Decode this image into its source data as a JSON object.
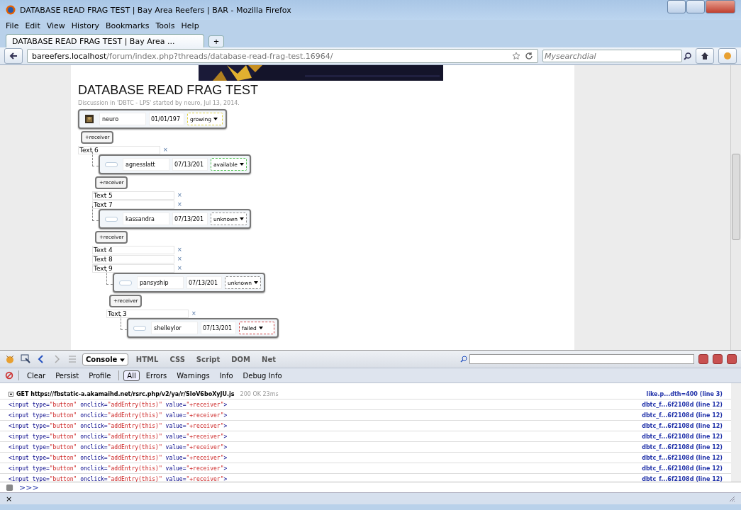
{
  "window": {
    "title": "DATABASE READ FRAG TEST | Bay Area Reefers | BAR - Mozilla Firefox"
  },
  "menu": [
    "File",
    "Edit",
    "View",
    "History",
    "Bookmarks",
    "Tools",
    "Help"
  ],
  "tabs": [
    {
      "label": "DATABASE READ FRAG TEST | Bay Area ...",
      "selected": true
    }
  ],
  "new_tab": "+",
  "address": {
    "host": "bareefers.localhost",
    "path": "/forum/index.php?threads/database-read-frag-test.16964/"
  },
  "search": {
    "placeholder": "Mysearchdial"
  },
  "page": {
    "title": "DATABASE READ FRAG TEST",
    "meta": "Discussion in 'DBTC - LPS' started by neuro, Jul 13, 2014.",
    "tree": {
      "card": {
        "name": "neuro",
        "date": "01/01/197",
        "status": {
          "label": "growing",
          "color": "#e0d040"
        }
      },
      "button": "+receiver",
      "texts": [
        {
          "value": "Text 6",
          "remove": "×"
        }
      ],
      "children": [
        {
          "card": {
            "kind": "blank",
            "name": "agnesslatt",
            "date": "07/13/201",
            "status": {
              "label": "available",
              "color": "#50c050"
            }
          },
          "button": "+receiver",
          "texts": [
            {
              "value": "Text 5",
              "remove": "×"
            },
            {
              "value": "Text 7",
              "remove": "×"
            }
          ]
        },
        {
          "card": {
            "kind": "blank",
            "name": "kassandra",
            "date": "07/13/201",
            "status": {
              "label": "unknown",
              "color": "#909090"
            }
          },
          "button": "+receiver",
          "texts": [
            {
              "value": "Text 4",
              "remove": "×"
            },
            {
              "value": "Text 8",
              "remove": "×"
            },
            {
              "value": "Text 9",
              "remove": "×"
            }
          ],
          "children": [
            {
              "card": {
                "kind": "blank",
                "name": "pansyship",
                "date": "07/13/201",
                "status": {
                  "label": "unknown",
                  "color": "#909090"
                }
              },
              "button": "+receiver",
              "texts": [
                {
                  "value": "Text 3",
                  "remove": "×"
                }
              ],
              "children": [
                {
                  "card": {
                    "kind": "blank",
                    "name": "shelleylor",
                    "date": "07/13/201",
                    "status": {
                      "label": "failed",
                      "color": "#d04040"
                    }
                  }
                }
              ]
            }
          ]
        }
      ]
    }
  },
  "firebug": {
    "panel_menu": "Console",
    "panels": [
      {
        "label": "HTML",
        "selected": false
      },
      {
        "label": "CSS",
        "selected": false
      },
      {
        "label": "Script",
        "selected": false
      },
      {
        "label": "DOM",
        "selected": false
      },
      {
        "label": "Net",
        "selected": false
      }
    ],
    "actions": [
      "Clear",
      "Persist",
      "Profile"
    ],
    "filters": [
      {
        "label": "All",
        "selected": true
      },
      {
        "label": "Errors",
        "selected": false
      },
      {
        "label": "Warnings",
        "selected": false
      },
      {
        "label": "Info",
        "selected": false
      },
      {
        "label": "Debug Info",
        "selected": false
      }
    ],
    "log": [
      {
        "kind": "request",
        "text": "GET https://fbstatic-a.akamaihd.net/rsrc.php/v2/ya/r/SIoV6boXyJU.js",
        "status": "200 OK 23ms",
        "source": "like.p...dth=400 (line 3)"
      },
      {
        "kind": "markup",
        "parts": [
          {
            "kind": "tag",
            "text": "<input type="
          },
          {
            "kind": "value",
            "text": "\"button\""
          },
          {
            "kind": "tag",
            "text": " onclick="
          },
          {
            "kind": "value",
            "text": "\"addEntry(this)\""
          },
          {
            "kind": "tag",
            "text": " value="
          },
          {
            "kind": "value",
            "text": "\"+receiver\""
          },
          {
            "kind": "tag",
            "text": ">"
          }
        ],
        "source": "dbtc_f...6f2108d (line 12)"
      },
      {
        "kind": "markup",
        "parts": [
          {
            "kind": "tag",
            "text": "<input type="
          },
          {
            "kind": "value",
            "text": "\"button\""
          },
          {
            "kind": "tag",
            "text": " onclick="
          },
          {
            "kind": "value",
            "text": "\"addEntry(this)\""
          },
          {
            "kind": "tag",
            "text": " value="
          },
          {
            "kind": "value",
            "text": "\"+receiver\""
          },
          {
            "kind": "tag",
            "text": ">"
          }
        ],
        "source": "dbtc_f...6f2108d (line 12)"
      },
      {
        "kind": "markup",
        "parts": [
          {
            "kind": "tag",
            "text": "<input type="
          },
          {
            "kind": "value",
            "text": "\"button\""
          },
          {
            "kind": "tag",
            "text": " onclick="
          },
          {
            "kind": "value",
            "text": "\"addEntry(this)\""
          },
          {
            "kind": "tag",
            "text": " value="
          },
          {
            "kind": "value",
            "text": "\"+receiver\""
          },
          {
            "kind": "tag",
            "text": ">"
          }
        ],
        "source": "dbtc_f...6f2108d (line 12)"
      },
      {
        "kind": "markup",
        "parts": [
          {
            "kind": "tag",
            "text": "<input type="
          },
          {
            "kind": "value",
            "text": "\"button\""
          },
          {
            "kind": "tag",
            "text": " onclick="
          },
          {
            "kind": "value",
            "text": "\"addEntry(this)\""
          },
          {
            "kind": "tag",
            "text": " value="
          },
          {
            "kind": "value",
            "text": "\"+receiver\""
          },
          {
            "kind": "tag",
            "text": ">"
          }
        ],
        "source": "dbtc_f...6f2108d (line 12)"
      },
      {
        "kind": "markup",
        "parts": [
          {
            "kind": "tag",
            "text": "<input type="
          },
          {
            "kind": "value",
            "text": "\"button\""
          },
          {
            "kind": "tag",
            "text": " onclick="
          },
          {
            "kind": "value",
            "text": "\"addEntry(this)\""
          },
          {
            "kind": "tag",
            "text": " value="
          },
          {
            "kind": "value",
            "text": "\"+receiver\""
          },
          {
            "kind": "tag",
            "text": ">"
          }
        ],
        "source": "dbtc_f...6f2108d (line 12)"
      },
      {
        "kind": "markup",
        "parts": [
          {
            "kind": "tag",
            "text": "<input type="
          },
          {
            "kind": "value",
            "text": "\"button\""
          },
          {
            "kind": "tag",
            "text": " onclick="
          },
          {
            "kind": "value",
            "text": "\"addEntry(this)\""
          },
          {
            "kind": "tag",
            "text": " value="
          },
          {
            "kind": "value",
            "text": "\"+receiver\""
          },
          {
            "kind": "tag",
            "text": ">"
          }
        ],
        "source": "dbtc_f...6f2108d (line 12)"
      },
      {
        "kind": "markup",
        "parts": [
          {
            "kind": "tag",
            "text": "<input type="
          },
          {
            "kind": "value",
            "text": "\"button\""
          },
          {
            "kind": "tag",
            "text": " onclick="
          },
          {
            "kind": "value",
            "text": "\"addEntry(this)\""
          },
          {
            "kind": "tag",
            "text": " value="
          },
          {
            "kind": "value",
            "text": "\"+receiver\""
          },
          {
            "kind": "tag",
            "text": ">"
          }
        ],
        "source": "dbtc_f...6f2108d (line 12)"
      },
      {
        "kind": "markup",
        "parts": [
          {
            "kind": "tag",
            "text": "<input type="
          },
          {
            "kind": "value",
            "text": "\"button\""
          },
          {
            "kind": "tag",
            "text": " onclick="
          },
          {
            "kind": "value",
            "text": "\"addEntry(this)\""
          },
          {
            "kind": "tag",
            "text": " value="
          },
          {
            "kind": "value",
            "text": "\"+receiver\""
          },
          {
            "kind": "tag",
            "text": ">"
          }
        ],
        "source": "dbtc_f...6f2108d (line 12)"
      }
    ],
    "prompt": ">>>",
    "close": "×"
  }
}
